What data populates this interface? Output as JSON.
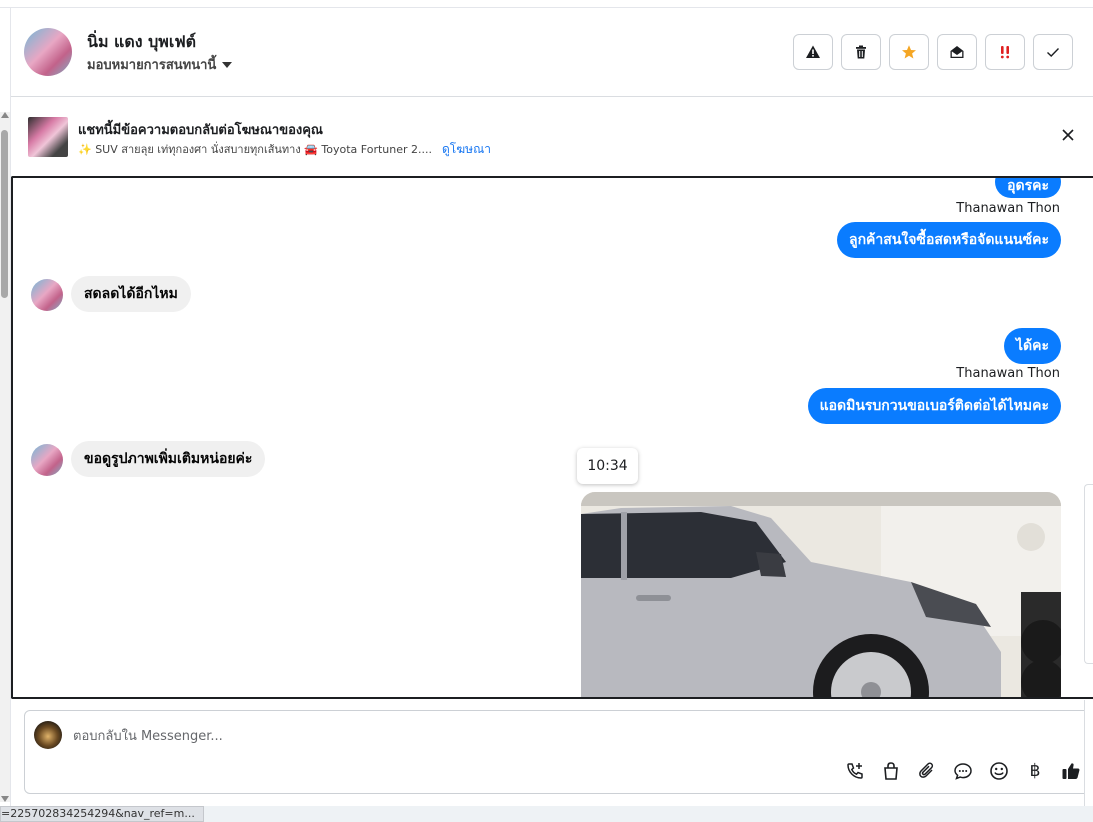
{
  "header": {
    "name": "นิ่ม แดง บุพเฟต์",
    "assign_label": "มอบหมายการสนทนานี้"
  },
  "ad": {
    "title": "แชทนี้มีข้อความตอบกลับต่อโฆษณาของคุณ",
    "subtitle": "✨ SUV สายลุย เท่ทุกองศา นั่งสบายทุกเส้นทาง 🚘 Toyota Fortuner 2....",
    "link": "ดูโฆษณา"
  },
  "messages": {
    "out_partial": "อุดรคะ",
    "sender_1": "Thanawan Thon",
    "out_1": "ลูกค้าสนใจซื้อสดหรือจัดแนนซ์คะ",
    "in_1": "สดลดได้อีกไหม",
    "out_2": "ได้คะ",
    "sender_2": "Thanawan Thon",
    "out_3": "แอดมินรบกวนขอเบอร์ติดต่อได้ไหมคะ",
    "in_2": "ขอดูรูปภาพเพิ่มเติมหน่อยค่ะ",
    "time": "10:34"
  },
  "composer": {
    "placeholder": "ตอบกลับใน Messenger..."
  },
  "tools": {
    "baht": "฿"
  },
  "status_url": "=225702834254294&nav_ref=m..."
}
